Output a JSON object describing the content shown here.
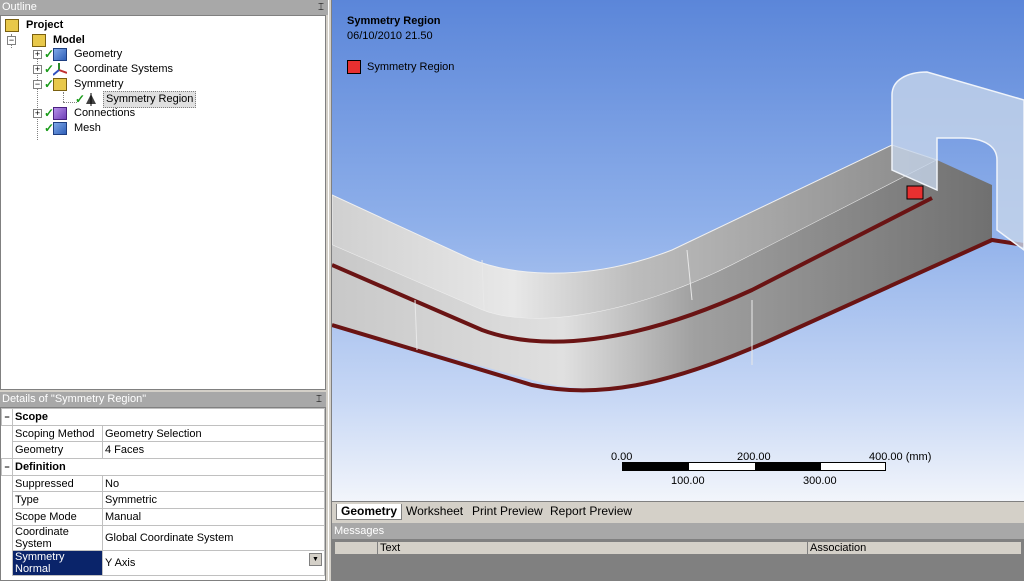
{
  "outline": {
    "title": "Outline",
    "pin": "⍄",
    "tree": [
      {
        "label": "Project"
      },
      {
        "label": "Model"
      },
      {
        "label": "Geometry"
      },
      {
        "label": "Coordinate Systems"
      },
      {
        "label": "Symmetry"
      },
      {
        "label": "Symmetry Region"
      },
      {
        "label": "Connections"
      },
      {
        "label": "Mesh"
      }
    ]
  },
  "details": {
    "title": "Details of \"Symmetry Region\"",
    "groups": [
      {
        "name": "Scope",
        "rows": [
          {
            "label": "Scoping Method",
            "value": "Geometry Selection"
          },
          {
            "label": "Geometry",
            "value": "4 Faces"
          }
        ]
      },
      {
        "name": "Definition",
        "rows": [
          {
            "label": "Suppressed",
            "value": "No"
          },
          {
            "label": "Type",
            "value": "Symmetric"
          },
          {
            "label": "Scope Mode",
            "value": "Manual"
          },
          {
            "label": "Coordinate System",
            "value": "Global Coordinate System"
          },
          {
            "label": "Symmetry Normal",
            "value": "Y Axis"
          }
        ]
      }
    ]
  },
  "viewport": {
    "title": "Symmetry Region",
    "date": "06/10/2010 21.50",
    "legend_label": "Symmetry Region",
    "legend_color": "#e83030",
    "scale": {
      "top_labels": [
        "0.00",
        "200.00",
        "400.00 (mm)"
      ],
      "bottom_labels": [
        "100.00",
        "300.00"
      ]
    }
  },
  "tabs": [
    "Geometry",
    "Worksheet",
    "Print Preview",
    "Report Preview"
  ],
  "messages": {
    "title": "Messages",
    "columns": [
      "Text",
      "Association"
    ]
  }
}
